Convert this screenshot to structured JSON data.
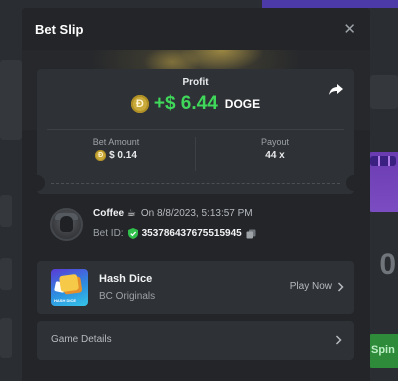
{
  "modal": {
    "title": "Bet Slip",
    "close_icon": "close-icon"
  },
  "profit": {
    "label": "Profit",
    "amount": "+$ 6.44",
    "currency": "DOGE",
    "coin_symbol": "Ð",
    "share_icon": "share-icon",
    "color": "#3fd85a"
  },
  "stats": {
    "bet_amount_label": "Bet Amount",
    "bet_amount_value": "$ 0.14",
    "payout_label": "Payout",
    "payout_value": "44 x"
  },
  "player": {
    "name": "Coffee",
    "emoji": "☕",
    "timestamp": "On 8/8/2023, 5:13:57 PM",
    "bet_id_label": "Bet ID:",
    "bet_id": "353786437675515945"
  },
  "game": {
    "name": "Hash Dice",
    "provider": "BC Originals",
    "play_label": "Play Now",
    "thumb_tag": "HASH DICE"
  },
  "details": {
    "label": "Game Details"
  }
}
